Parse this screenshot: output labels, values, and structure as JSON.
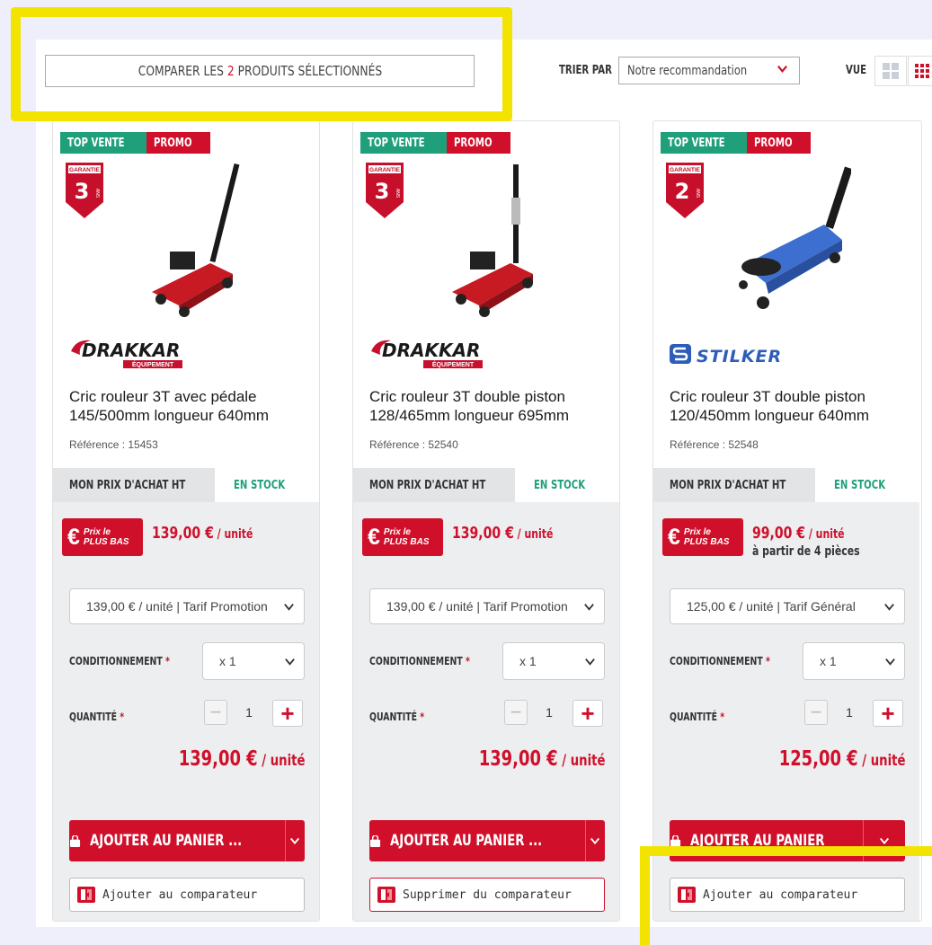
{
  "toolbar": {
    "compare_prefix": "COMPARER LES ",
    "compare_count": "2",
    "compare_suffix": " PRODUITS SÉLECTIONNÉS",
    "sort_label": "TRIER PAR",
    "sort_value": "Notre recommandation",
    "view_label": "VUE"
  },
  "colors": {
    "accent": "#d0102b",
    "stock": "#1f9f7a",
    "highlight": "#f2e300"
  },
  "products": [
    {
      "badges": [
        "TOP VENTE",
        "PROMO"
      ],
      "garantie_label": "GARANTIE",
      "garantie_years": "3",
      "garantie_unit": "ANS",
      "brand": "DRAKKAR",
      "brand_sub": "ÉQUIPEMENT",
      "name": "Cric rouleur 3T avec pédale 145/500mm longueur 640mm",
      "reference": "Référence : 15453",
      "price_tab": "MON PRIX D'ACHAT HT",
      "stock": "EN STOCK",
      "lowest_line1": "Prix le",
      "lowest_line2": "PLUS BAS",
      "unit_price": "139,00 €",
      "unit_suffix": " / unité",
      "from_text": "",
      "tarif_option": "139,00 € / unité | Tarif Promotion",
      "cond_label": "CONDITIONNEMENT",
      "cond_value": "x 1",
      "qty_label": "QUANTITÉ",
      "qty_value": "1",
      "total_price": "139,00 €",
      "total_suffix": " / unité",
      "add_to_cart": "AJOUTER AU PANIER ...",
      "compare_action": "Ajouter au comparateur",
      "in_comparator": false
    },
    {
      "badges": [
        "TOP VENTE",
        "PROMO"
      ],
      "garantie_label": "GARANTIE",
      "garantie_years": "3",
      "garantie_unit": "ANS",
      "brand": "DRAKKAR",
      "brand_sub": "ÉQUIPEMENT",
      "name": "Cric rouleur 3T double piston 128/465mm longueur 695mm",
      "reference": "Référence : 52540",
      "price_tab": "MON PRIX D'ACHAT HT",
      "stock": "EN STOCK",
      "lowest_line1": "Prix le",
      "lowest_line2": "PLUS BAS",
      "unit_price": "139,00 €",
      "unit_suffix": " / unité",
      "from_text": "",
      "tarif_option": "139,00 € / unité | Tarif Promotion",
      "cond_label": "CONDITIONNEMENT",
      "cond_value": "x 1",
      "qty_label": "QUANTITÉ",
      "qty_value": "1",
      "total_price": "139,00 €",
      "total_suffix": " / unité",
      "add_to_cart": "AJOUTER AU PANIER ...",
      "compare_action": "Supprimer du comparateur",
      "in_comparator": true
    },
    {
      "badges": [
        "TOP VENTE",
        "PROMO"
      ],
      "garantie_label": "GARANTIE",
      "garantie_years": "2",
      "garantie_unit": "ANS",
      "brand": "STILKER",
      "brand_sub": "",
      "name": "Cric rouleur 3T double piston 120/450mm longueur 640mm",
      "reference": "Référence : 52548",
      "price_tab": "MON PRIX D'ACHAT HT",
      "stock": "EN STOCK",
      "lowest_line1": "Prix le",
      "lowest_line2": "PLUS BAS",
      "unit_price": "99,00 €",
      "unit_suffix": " / unité",
      "from_text": "à partir de 4 pièces",
      "tarif_option": "125,00 € / unité | Tarif Général",
      "cond_label": "CONDITIONNEMENT",
      "cond_value": "x 1",
      "qty_label": "QUANTITÉ",
      "qty_value": "1",
      "total_price": "125,00 €",
      "total_suffix": " / unité",
      "add_to_cart": "AJOUTER AU PANIER",
      "compare_action": "Ajouter au comparateur",
      "in_comparator": false
    }
  ]
}
